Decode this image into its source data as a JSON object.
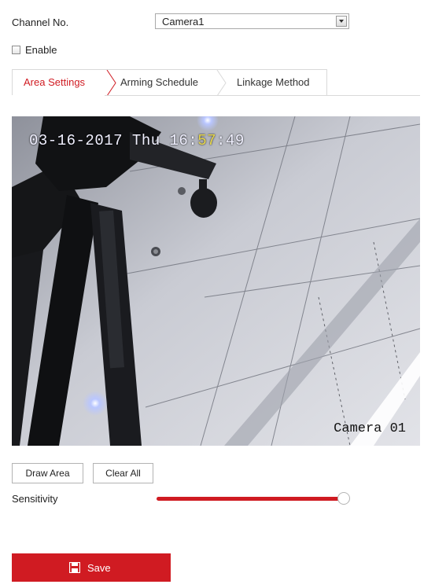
{
  "channel": {
    "label": "Channel No.",
    "selected": "Camera1"
  },
  "enable": {
    "label": "Enable",
    "checked": false
  },
  "tabs": [
    {
      "label": "Area Settings",
      "active": true
    },
    {
      "label": "Arming Schedule",
      "active": false
    },
    {
      "label": "Linkage Method",
      "active": false
    }
  ],
  "video": {
    "timestamp": "03-16-2017 Thu 16:57:49",
    "camera_name": "Camera 01"
  },
  "buttons": {
    "draw_area": "Draw Area",
    "clear_all": "Clear All",
    "save": "Save"
  },
  "sensitivity": {
    "label": "Sensitivity",
    "value_fraction": 0.97
  },
  "colors": {
    "accent": "#d01b22"
  }
}
